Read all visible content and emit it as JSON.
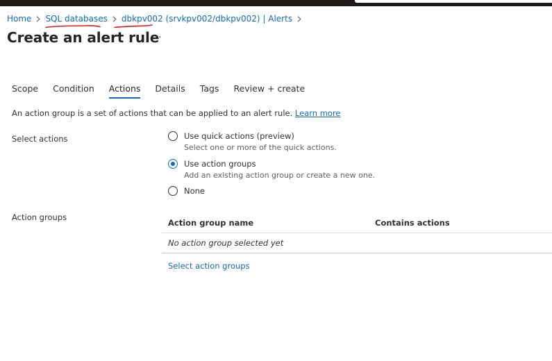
{
  "breadcrumb": {
    "items": [
      "Home",
      "SQL databases",
      "dbkpv002 (srvkpv002/dbkpv002) | Alerts"
    ]
  },
  "page": {
    "title": "Create an alert rule",
    "more_label": "···"
  },
  "tabs": [
    {
      "label": "Scope",
      "active": false
    },
    {
      "label": "Condition",
      "active": false
    },
    {
      "label": "Actions",
      "active": true
    },
    {
      "label": "Details",
      "active": false
    },
    {
      "label": "Tags",
      "active": false
    },
    {
      "label": "Review + create",
      "active": false
    }
  ],
  "intro": {
    "text": "An action group is a set of actions that can be applied to an alert rule.",
    "link": "Learn more"
  },
  "select_actions": {
    "label": "Select actions",
    "options": [
      {
        "label": "Use quick actions (preview)",
        "description": "Select one or more of the quick actions.",
        "checked": false
      },
      {
        "label": "Use action groups",
        "description": "Add an existing action group or create a new one.",
        "checked": true
      },
      {
        "label": "None",
        "description": "",
        "checked": false
      }
    ]
  },
  "action_groups": {
    "label": "Action groups",
    "columns": [
      "Action group name",
      "Contains actions"
    ],
    "empty_text": "No action group selected yet",
    "select_link": "Select action groups"
  },
  "colors": {
    "accent": "#0f6cbd",
    "annotation": "#e3171b",
    "topbar": "#1b1a19"
  },
  "icons": {
    "breadcrumb_separator": "chevron-right-icon",
    "more": "ellipsis-icon"
  }
}
